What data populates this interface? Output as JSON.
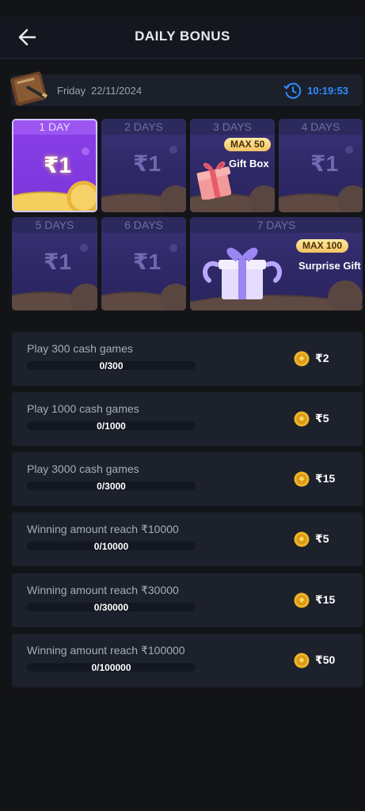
{
  "header": {
    "title": "DAILY BONUS",
    "back_icon": "arrow-left-icon"
  },
  "date_bar": {
    "day": "Friday",
    "date": "22/11/2024",
    "time": "10:19:53",
    "time_color": "#2f8cff"
  },
  "days": [
    {
      "label": "1 DAY",
      "amount": "₹1",
      "state": "current"
    },
    {
      "label": "2 DAYS",
      "amount": "₹1",
      "state": "locked"
    },
    {
      "label": "3 DAYS",
      "max": "MAX 50",
      "gift": "Gift Box",
      "state": "locked"
    },
    {
      "label": "4 DAYS",
      "amount": "₹1",
      "state": "locked"
    },
    {
      "label": "5 DAYS",
      "amount": "₹1",
      "state": "locked"
    },
    {
      "label": "6 DAYS",
      "amount": "₹1",
      "state": "locked"
    },
    {
      "label": "7 DAYS",
      "max": "MAX 100",
      "gift": "Surprise Gift",
      "state": "locked"
    }
  ],
  "tasks": [
    {
      "title": "Play 300 cash games",
      "progress_text": "0/300",
      "progress": 0,
      "reward": "₹2"
    },
    {
      "title": "Play 1000 cash games",
      "progress_text": "0/1000",
      "progress": 0,
      "reward": "₹5"
    },
    {
      "title": "Play 3000 cash games",
      "progress_text": "0/3000",
      "progress": 0,
      "reward": "₹15"
    },
    {
      "title": "Winning amount reach ₹10000",
      "progress_text": "0/10000",
      "progress": 0,
      "reward": "₹5"
    },
    {
      "title": "Winning amount reach ₹30000",
      "progress_text": "0/30000",
      "progress": 0,
      "reward": "₹15"
    },
    {
      "title": "Winning amount reach ₹100000",
      "progress_text": "0/100000",
      "progress": 0,
      "reward": "₹50"
    }
  ],
  "colors": {
    "background": "#131417",
    "card": "#1c212c",
    "accent_purple": "#8a3ee8",
    "coin_gold": "#f0b429"
  }
}
